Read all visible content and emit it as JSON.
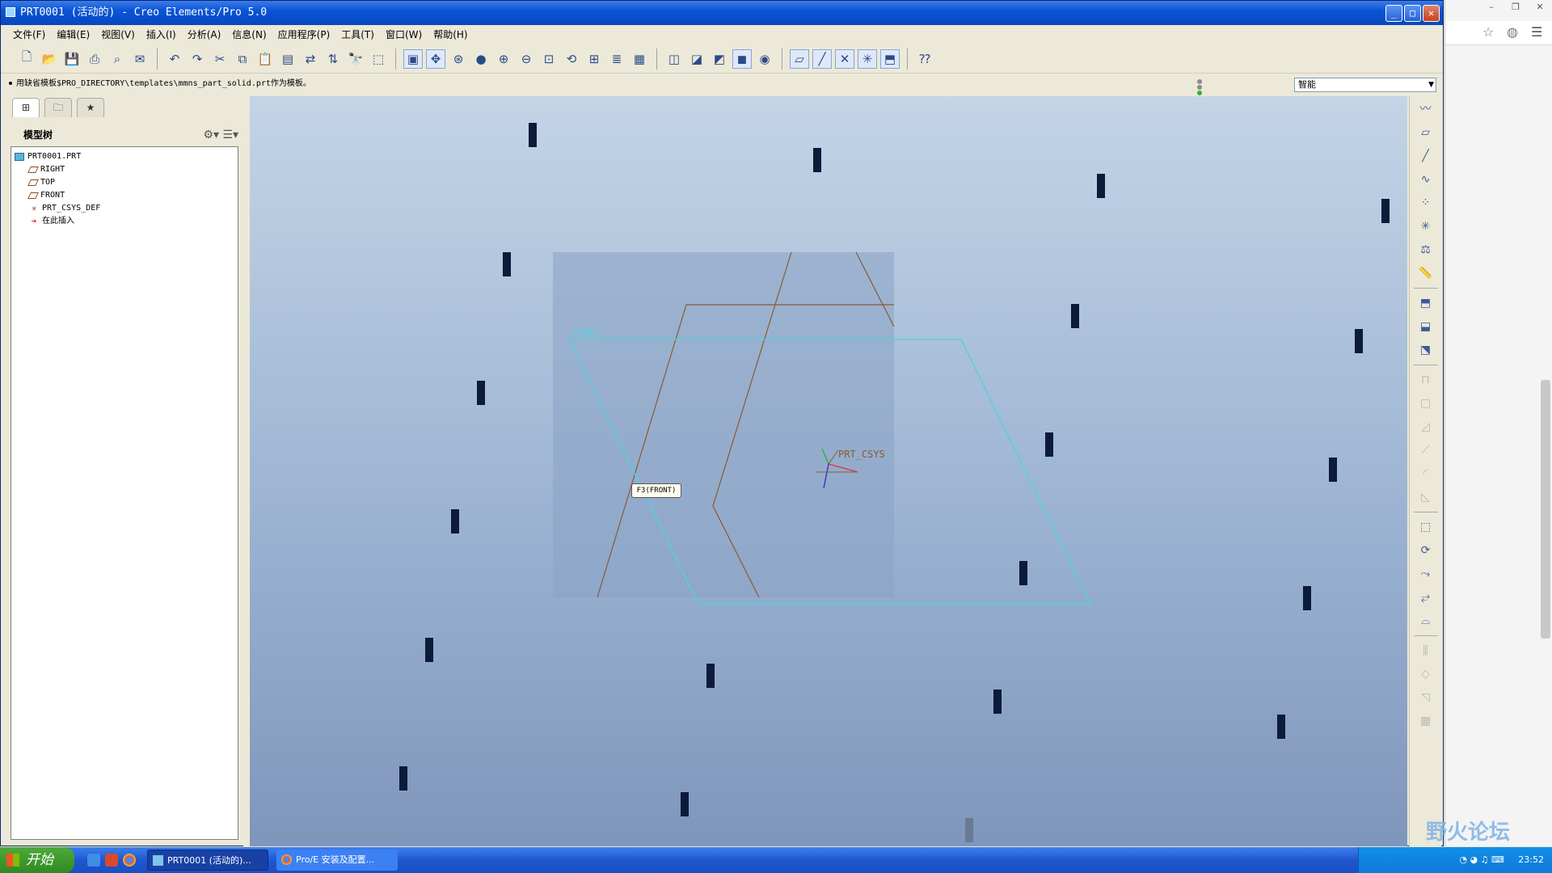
{
  "window": {
    "title": "PRT0001 (活动的) - Creo Elements/Pro 5.0",
    "controls": [
      "_",
      "□",
      "✕"
    ]
  },
  "menu": [
    "文件(F)",
    "编辑(E)",
    "视图(V)",
    "插入(I)",
    "分析(A)",
    "信息(N)",
    "应用程序(P)",
    "工具(T)",
    "窗口(W)",
    "帮助(H)"
  ],
  "message": "用缺省模板$PRO_DIRECTORY\\templates\\mmns_part_solid.prt作为模板。",
  "filter": {
    "value": "智能"
  },
  "model_tree": {
    "title": "模型树",
    "items": [
      {
        "label": "PRT0001.PRT",
        "icon": "part-icon"
      },
      {
        "label": "RIGHT",
        "icon": "datum-plane-icon"
      },
      {
        "label": "TOP",
        "icon": "datum-plane-icon"
      },
      {
        "label": "FRONT",
        "icon": "datum-plane-icon"
      },
      {
        "label": "PRT_CSYS_DEF",
        "icon": "csys-icon"
      },
      {
        "label": "在此插入",
        "icon": "insert-here-icon"
      }
    ]
  },
  "viewport": {
    "plane_label": "FRONT",
    "csys_label": "PRT_CSYS",
    "tooltip": "F3(FRONT)"
  },
  "colors": {
    "titlebar": "#0a55d6",
    "viewport_top": "#c3d4e6",
    "viewport_bottom": "#7f96bb",
    "plane_front": "#4fd3e0",
    "plane_other": "#8a5a34"
  },
  "taskbar": {
    "start": "开始",
    "tasks": [
      "PRT0001 (活动的)...",
      "Pro/E 安装及配置..."
    ],
    "clock": "23:52"
  },
  "watermark": "野火论坛"
}
